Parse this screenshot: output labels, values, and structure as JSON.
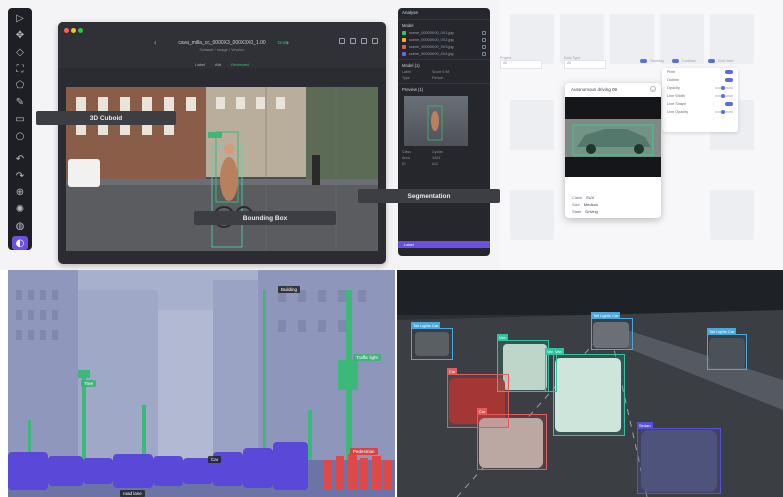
{
  "annotation_tool": {
    "file_title": "cava_milla_cc_0000X3_000X3X0_1.00",
    "file_subtitle": "Dataset / Image / Version",
    "file_status": "Done",
    "tags": [
      "Label",
      "Attr",
      "Reviewed"
    ],
    "toolbar_icons": [
      "pointer-icon",
      "move-icon",
      "tag-icon",
      "box-icon",
      "polygon-icon",
      "brush-icon",
      "trash-icon",
      "circle-icon",
      "undo-icon",
      "redo-icon",
      "zoom-icon",
      "brightness-icon",
      "settings-icon",
      "contrast-icon"
    ],
    "overlay_labels": {
      "cuboid": "3D Cuboid",
      "bounding_box": "Bounding Box",
      "segmentation": "Segmentation"
    },
    "right_panel": {
      "header": "Analyse",
      "section_files": "Model",
      "files": [
        {
          "name": "scene_00000X00_0X1.jpg",
          "color": "#38c172"
        },
        {
          "name": "scene_00000X00_0X2.jpg",
          "color": "#f0b429"
        },
        {
          "name": "scene_00000X00_0X3.jpg",
          "color": "#e25c5c"
        },
        {
          "name": "scene_00000X00_0X4.jpg",
          "color": "#5a6ee0"
        }
      ],
      "section_model": "Model (1)",
      "model_rows": [
        {
          "k": "Label",
          "v": "Score 0.98"
        },
        {
          "k": "Type",
          "v": "Person"
        }
      ],
      "section_preview": "Preview (1)",
      "preview_rows": [
        {
          "k": "Class",
          "v": "Cyclist"
        },
        {
          "k": "Area",
          "v": "1024"
        },
        {
          "k": "ID",
          "v": "#12"
        }
      ],
      "selected_row": "Label"
    }
  },
  "gallery": {
    "fields": [
      {
        "label": "Project",
        "value": "All"
      },
      {
        "label": "Data Type",
        "value": "All"
      }
    ],
    "toggles": [
      "Tracking",
      "Contrast",
      "Grid View"
    ],
    "popover": {
      "rows": [
        {
          "label": "Pixel",
          "control": "toggle"
        },
        {
          "label": "Outline",
          "control": "toggle"
        },
        {
          "label": "Opacity",
          "control": "slider"
        },
        {
          "label": "Line Width",
          "control": "slider"
        },
        {
          "label": "Line Shape",
          "control": "toggle"
        },
        {
          "label": "Line Opacity",
          "control": "slider"
        }
      ]
    },
    "card": {
      "title": "Autonomous driving 09",
      "meta": [
        {
          "k": "Class",
          "v": "SUV"
        },
        {
          "k": "Size",
          "v": "Medium"
        },
        {
          "k": "State",
          "v": "Driving"
        }
      ]
    }
  },
  "segmentation_view": {
    "tags": [
      {
        "text": "Building",
        "type": "dark"
      },
      {
        "text": "Traffic light",
        "type": "green"
      },
      {
        "text": "Tree",
        "type": "green"
      },
      {
        "text": "Car",
        "type": "dark"
      },
      {
        "text": "Pedestrian",
        "type": "red"
      },
      {
        "text": "road lane",
        "type": "dark"
      }
    ]
  },
  "detection_view": {
    "boxes": [
      {
        "text": "Tail Lights Car",
        "color": "#4aa8e0"
      },
      {
        "text": "Tail Lights Car",
        "color": "#4aa8e0"
      },
      {
        "text": "Tail Lights Car",
        "color": "#4aa8e0"
      },
      {
        "text": "Van",
        "color": "#2ec4a0"
      },
      {
        "text": "Van",
        "color": "#2ec4a0"
      },
      {
        "text": "Van",
        "color": "#2ec4a0"
      },
      {
        "text": "Car",
        "color": "#e25c5c"
      },
      {
        "text": "Car",
        "color": "#e25c5c"
      },
      {
        "text": "Sedan",
        "color": "#5a50d8"
      }
    ]
  },
  "colors": {
    "accent": "#6c4fe0",
    "segmentation_green": "#3cb878",
    "pedestrian_red": "#e04848",
    "vehicle_blue": "#5a50d8"
  }
}
